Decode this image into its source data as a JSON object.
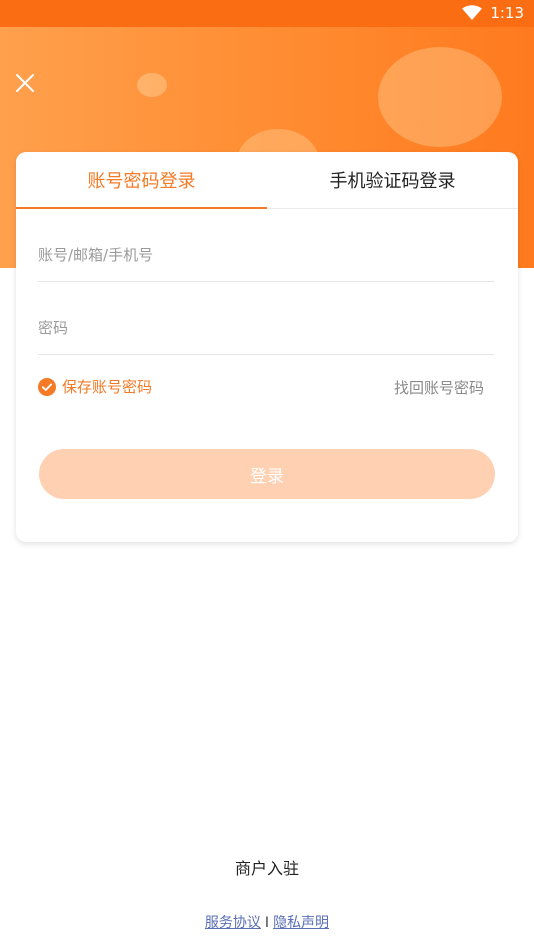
{
  "status_bar": {
    "time": "1:13",
    "wifi_icon": "wifi-icon",
    "background": "#fb6d12"
  },
  "header": {
    "close_icon": "close-icon",
    "accent_color": "#f47a25"
  },
  "login_card": {
    "tabs": [
      {
        "label": "账号密码登录",
        "active": true
      },
      {
        "label": "手机验证码登录",
        "active": false
      }
    ],
    "account_input": {
      "value": "",
      "placeholder": "账号/邮箱/手机号"
    },
    "password_input": {
      "value": "",
      "placeholder": "密码"
    },
    "remember": {
      "label": "保存账号密码",
      "checked": true,
      "icon": "check-circle-icon"
    },
    "forgot_label": "找回账号密码",
    "login_label": "登录",
    "login_button_color": "#ffd1b2"
  },
  "merchant_label": "商户入驻",
  "footer": {
    "service_label": "服务协议",
    "separator": "I",
    "privacy_label": "隐私声明",
    "link_color": "#5a6fb5"
  }
}
